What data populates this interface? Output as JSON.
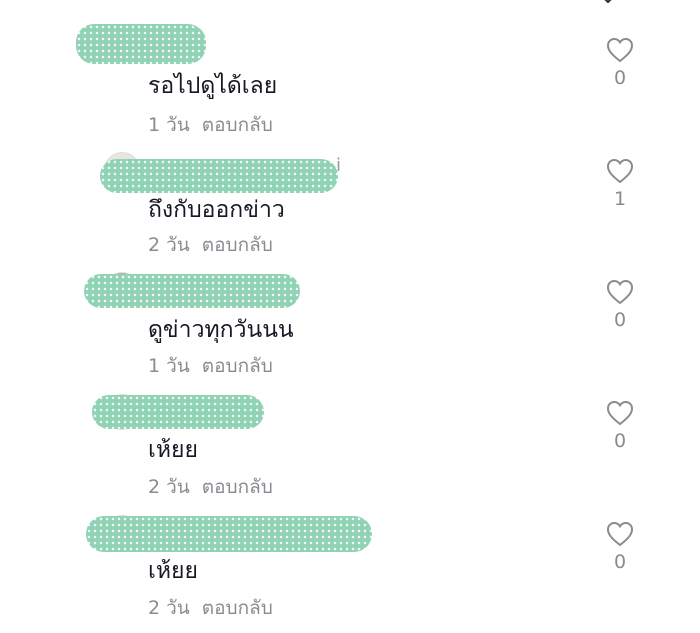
{
  "comments": [
    {
      "text": "รอไปดูได้เลย",
      "time": "1 วัน",
      "reply_label": "ตอบกลับ",
      "likes": "0",
      "username_stray": ""
    },
    {
      "text": "ถึงกับออกข่าว",
      "time": "2 วัน",
      "reply_label": "ตอบกลับ",
      "likes": "1",
      "username_stray": "i"
    },
    {
      "text": "ดูข่าวทุกวันนน",
      "time": "1 วัน",
      "reply_label": "ตอบกลับ",
      "likes": "0",
      "username_stray": ""
    },
    {
      "text": "เห้ยย",
      "time": "2 วัน",
      "reply_label": "ตอบกลับ",
      "likes": "0",
      "username_stray": ""
    },
    {
      "text": "เห้ยย",
      "time": "2 วัน",
      "reply_label": "ตอบกลับ",
      "likes": "0",
      "username_stray": ""
    }
  ],
  "colors": {
    "redaction": "#8fd2b4",
    "text": "#161823",
    "muted": "#8a8b91",
    "icon": "#8a8b91"
  },
  "icons": {
    "close": "close-icon",
    "like": "heart-outline-icon"
  }
}
